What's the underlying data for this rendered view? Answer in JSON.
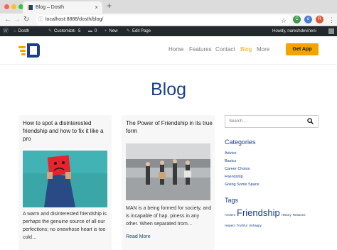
{
  "browser": {
    "tab_title": "Blog – Dosth",
    "tab_close": "×",
    "new_tab": "+",
    "url": "localhost:8888/dosth/blog/",
    "back": "←",
    "forward": "→",
    "reload": "↻",
    "info": "ⓘ",
    "star": "☆",
    "ext_green": "C",
    "ext_blue": "e",
    "profile": "R",
    "menu": "⋮",
    "traffic_colors": [
      "#ff5f57",
      "#ffbd2e",
      "#28c940"
    ]
  },
  "admin_bar": {
    "wp_icon": "Ⓦ",
    "site_name": "Dosth",
    "customize": "Customize",
    "updates": "5",
    "comments": "0",
    "new": "New",
    "edit_page": "Edit Page",
    "howdy": "Howdy, nareshdevineni"
  },
  "header": {
    "menu": [
      "Home",
      "Features",
      "Contact",
      "Blog",
      "More"
    ],
    "active": "Blog",
    "cta": "Get App"
  },
  "page_title": "Blog",
  "posts": [
    {
      "title": "How to spot a disinterested friendship and how to fix it like a pro",
      "excerpt": "A warm and disinterested friendship is perhaps the genuine source of all our perfections; no onewhose heart is too cold…",
      "image": "sad-face-person-photo"
    },
    {
      "title": "The Power of Friendship in its true form",
      "excerpt": "MAN is a being formed for society, and is incapable of hap. piness in any other. When separated trom…",
      "read_more": "Read More",
      "image": "friends-walking-photo"
    }
  ],
  "sidebar": {
    "search_placeholder": "Search …",
    "categories_title": "Categories",
    "categories": [
      "Advice",
      "Basics",
      "Career Choice",
      "Friendship",
      "Giving Some Space"
    ],
    "tags_title": "Tags",
    "tags": [
      {
        "name": "Ancient",
        "size": "small"
      },
      {
        "name": "Friendship",
        "size": "large"
      },
      {
        "name": "History",
        "size": "small"
      },
      {
        "name": "Reasons",
        "size": "small"
      },
      {
        "name": "respect",
        "size": "small"
      },
      {
        "name": "Truthful",
        "size": "small"
      },
      {
        "name": "Unhappy",
        "size": "small"
      }
    ]
  },
  "colors": {
    "brand_blue": "#1a3e8c",
    "accent": "#f5a300",
    "admin_bar": "#23282d"
  }
}
